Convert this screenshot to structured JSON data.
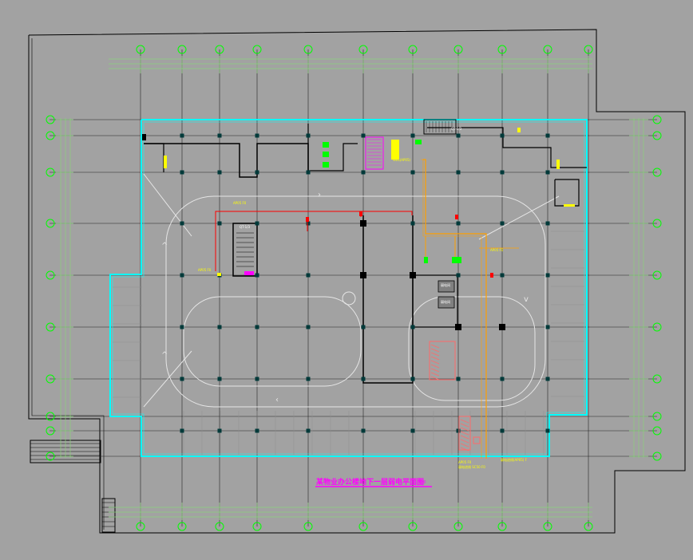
{
  "drawing": {
    "title": "某物业办公楼地下一层弱电平面图",
    "scale": "1:100",
    "background": "#a2a2a2",
    "colors": {
      "outline": "#000000",
      "axis_grid": "#8ad27c",
      "axis_bubble": "#00ff00",
      "cyan_wall": "#00ffff",
      "column": "#003a3a",
      "light_line": "#e6e6e6",
      "red_cable": "#ff0000",
      "orange_cable": "#ffa000",
      "magenta": "#ff00ff",
      "yellow": "#ffff00",
      "green_equipment": "#00ff00",
      "salmon": "#ff6a6a"
    },
    "labels": {
      "stair_a": "QT-1/3",
      "stair_b": "QT-1/3",
      "room_a": "弱电间",
      "room_b": "弱电间",
      "cable_a": "AP05 F0",
      "cable_b": "AP05 F0",
      "cable_c": "WEL(AP05)",
      "cable_d": "AP05 F0",
      "cable_e": "弱电进线(AP05) F",
      "cable_f": "AP05 F0",
      "cable_g": "弱电进线 SC50 F0"
    }
  }
}
